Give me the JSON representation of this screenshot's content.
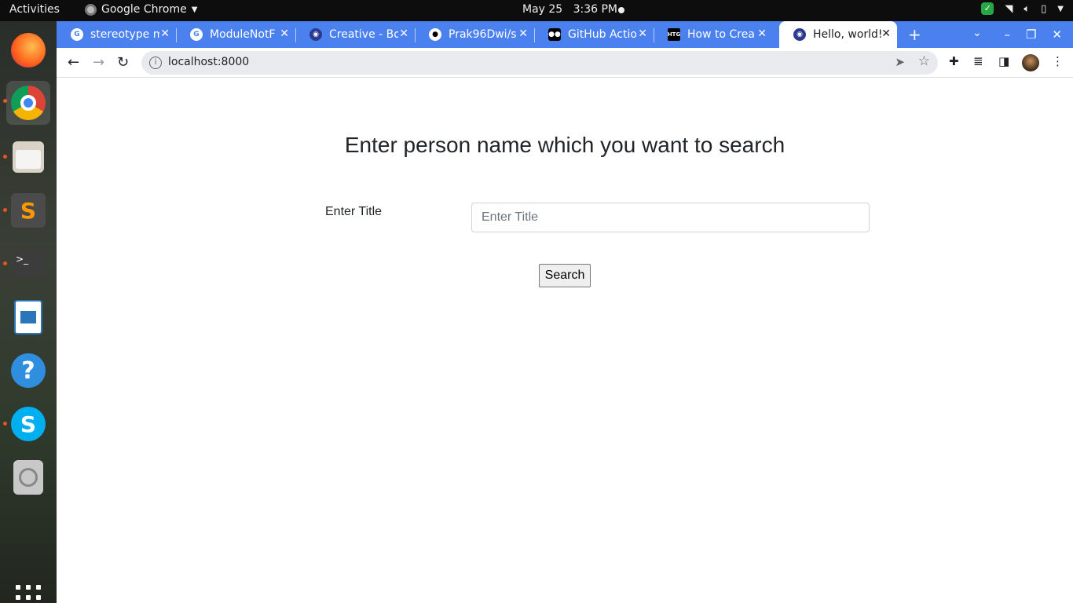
{
  "topbar": {
    "activities": "Activities",
    "app_name": "Google Chrome",
    "app_menu_icon": "chevron-down-icon",
    "date": "May 25",
    "time": "3:36 PM"
  },
  "dock": {
    "items": [
      {
        "name": "firefox",
        "running": false
      },
      {
        "name": "google-chrome",
        "running": true
      },
      {
        "name": "files",
        "running": true
      },
      {
        "name": "sublime-text",
        "running": true
      },
      {
        "name": "terminal",
        "running": true
      },
      {
        "name": "libreoffice-writer",
        "running": false
      },
      {
        "name": "help",
        "running": false
      },
      {
        "name": "skype",
        "running": true
      },
      {
        "name": "disk",
        "running": false
      }
    ]
  },
  "browser": {
    "tabs": [
      {
        "title": "stereotype m",
        "favicon": "google-icon"
      },
      {
        "title": "ModuleNotF",
        "favicon": "google-icon"
      },
      {
        "title": "Creative - Bo",
        "favicon": "globe-icon"
      },
      {
        "title": "Prak96Dwi/s",
        "favicon": "github-icon"
      },
      {
        "title": "GitHub Actio",
        "favicon": "medium-icon"
      },
      {
        "title": "How to Crea",
        "favicon": "htg-icon"
      },
      {
        "title": "Hello, world!",
        "favicon": "globe-icon",
        "active": true
      }
    ],
    "url": "localhost:8000"
  },
  "page": {
    "heading": "Enter person name which you want to search",
    "field_label": "Enter Title",
    "field_placeholder": "Enter Title",
    "field_value": "",
    "button_label": "Search"
  }
}
